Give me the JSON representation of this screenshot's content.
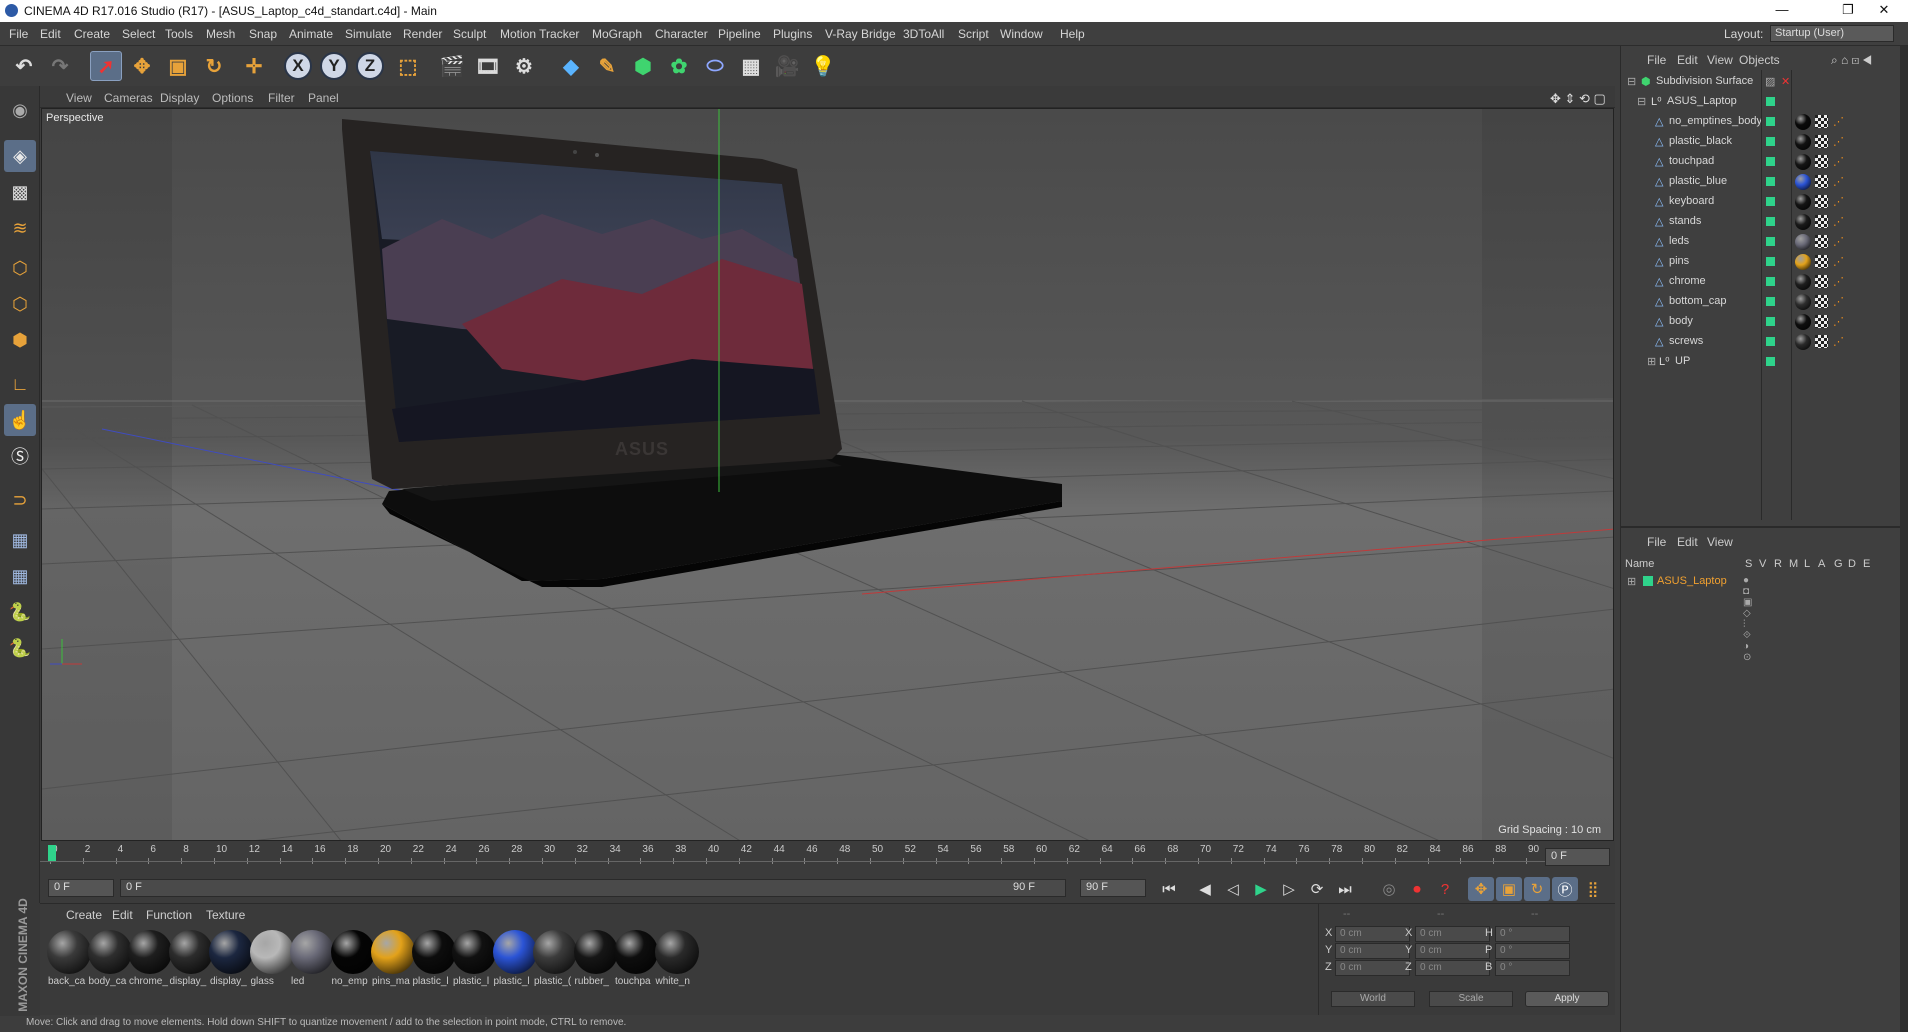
{
  "window": {
    "title": "CINEMA 4D R17.016 Studio (R17) - [ASUS_Laptop_c4d_standart.c4d] - Main",
    "min": "—",
    "restore": "❐",
    "close": "✕"
  },
  "menu": [
    "File",
    "Edit",
    "Create",
    "Select",
    "Tools",
    "Mesh",
    "Snap",
    "Animate",
    "Simulate",
    "Render",
    "Sculpt",
    "Motion Tracker",
    "MoGraph",
    "Character",
    "Pipeline",
    "Plugins",
    "V-Ray Bridge",
    "3DToAll",
    "Script",
    "Window",
    "Help"
  ],
  "layout": {
    "label": "Layout:",
    "value": "Startup (User)"
  },
  "viewport": {
    "menu": [
      "View",
      "Cameras",
      "Display",
      "Options",
      "Filter",
      "Panel"
    ],
    "camera_label": "Perspective",
    "grid_spacing": "Grid Spacing : 10 cm",
    "logo_text": "ASUS"
  },
  "timeline": {
    "ticks": [
      "0",
      "2",
      "4",
      "6",
      "8",
      "10",
      "12",
      "14",
      "16",
      "18",
      "20",
      "22",
      "24",
      "26",
      "28",
      "30",
      "32",
      "34",
      "36",
      "38",
      "40",
      "42",
      "44",
      "46",
      "48",
      "50",
      "52",
      "54",
      "56",
      "58",
      "60",
      "62",
      "64",
      "66",
      "68",
      "70",
      "72",
      "74",
      "76",
      "78",
      "80",
      "82",
      "84",
      "86",
      "88",
      "90"
    ],
    "end_field": "0 F",
    "current_frame": "0 F",
    "range_start": "0 F",
    "range_end": "90 F",
    "max_frame": "90 F"
  },
  "materials": {
    "menu": [
      "Create",
      "Edit",
      "Function",
      "Texture"
    ],
    "items": [
      {
        "name": "back_ca",
        "color": "#3a3a3a"
      },
      {
        "name": "body_ca",
        "color": "#2e2e2e"
      },
      {
        "name": "chrome_",
        "color": "#1e1e1e"
      },
      {
        "name": "display_",
        "color": "#2c2c2c"
      },
      {
        "name": "display_",
        "color": "#1c2740"
      },
      {
        "name": "glass",
        "color": "#b8b8b8"
      },
      {
        "name": "led",
        "color": "#6a6a78"
      },
      {
        "name": "no_emp",
        "color": "#050505"
      },
      {
        "name": "pins_ma",
        "color": "#e3a21a"
      },
      {
        "name": "plastic_l",
        "color": "#0d0d0d"
      },
      {
        "name": "plastic_l",
        "color": "#111111"
      },
      {
        "name": "plastic_l",
        "color": "#2b54d6"
      },
      {
        "name": "plastic_(",
        "color": "#3c3c3c"
      },
      {
        "name": "rubber_",
        "color": "#161616"
      },
      {
        "name": "touchpa",
        "color": "#0e0e0e"
      },
      {
        "name": "white_n",
        "color": "#2a2a2a"
      }
    ]
  },
  "coords": {
    "headers": [
      "--",
      "--",
      "--"
    ],
    "rows": [
      {
        "l1": "X",
        "v1": "0 cm",
        "l2": "X",
        "v2": "0 cm",
        "l3": "H",
        "v3": "0 °"
      },
      {
        "l1": "Y",
        "v1": "0 cm",
        "l2": "Y",
        "v2": "0 cm",
        "l3": "P",
        "v3": "0 °"
      },
      {
        "l1": "Z",
        "v1": "0 cm",
        "l2": "Z",
        "v2": "0 cm",
        "l3": "B",
        "v3": "0 °"
      }
    ],
    "space": "World",
    "mode": "Scale",
    "apply": "Apply"
  },
  "status": "Move: Click and drag to move elements. Hold down SHIFT to quantize movement / add to the selection in point mode, CTRL to remove.",
  "objects_panel": {
    "menu": [
      "File",
      "Edit",
      "View",
      "Objects"
    ],
    "root": "Subdivision Surface",
    "group": "ASUS_Laptop",
    "children": [
      {
        "name": "no_emptines_body",
        "mat": "#0a0a0a"
      },
      {
        "name": "plastic_black",
        "mat": "#111111"
      },
      {
        "name": "touchpad",
        "mat": "#151515"
      },
      {
        "name": "plastic_blue",
        "mat": "#2b54d6"
      },
      {
        "name": "keyboard",
        "mat": "#141414"
      },
      {
        "name": "stands",
        "mat": "#1a1a1a"
      },
      {
        "name": "leds",
        "mat": "#6a6a78"
      },
      {
        "name": "pins",
        "mat": "#e3a21a"
      },
      {
        "name": "chrome",
        "mat": "#1e1e1e"
      },
      {
        "name": "bottom_cap",
        "mat": "#2e2e2e"
      },
      {
        "name": "body",
        "mat": "#0e0e0e"
      },
      {
        "name": "screws",
        "mat": "#2a2a2a"
      }
    ],
    "extra": "UP"
  },
  "layers_panel": {
    "menu": [
      "File",
      "Edit",
      "View"
    ],
    "columns": [
      "Name",
      "S",
      "V",
      "R",
      "M",
      "L",
      "A",
      "G",
      "D",
      "E"
    ],
    "row": "ASUS_Laptop"
  }
}
